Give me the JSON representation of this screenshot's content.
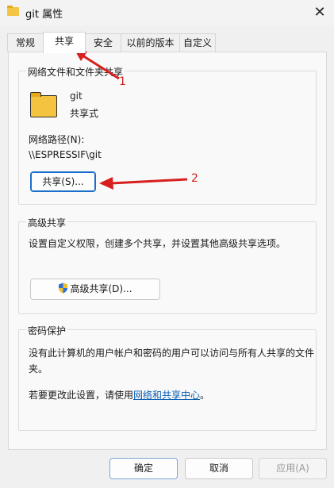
{
  "window": {
    "title": "git 属性",
    "close_glyph": "✕",
    "folder_icon": "folder-icon"
  },
  "tabs": [
    {
      "label": "常规"
    },
    {
      "label": "共享",
      "active": true
    },
    {
      "label": "安全"
    },
    {
      "label": "以前的版本"
    },
    {
      "label": "自定义"
    }
  ],
  "network_share": {
    "group_title": "网络文件和文件夹共享",
    "folder_name": "git",
    "share_status": "共享式",
    "path_label": "网络路径(N):",
    "path_value": "\\\\ESPRESSIF\\git",
    "share_button": "共享(S)..."
  },
  "advanced_share": {
    "group_title": "高级共享",
    "description": "设置自定义权限，创建多个共享，并设置其他高级共享选项。",
    "button": "高级共享(D)...",
    "button_icon": "uac-shield-icon"
  },
  "password_protection": {
    "group_title": "密码保护",
    "description_line1": "没有此计算机的用户帐户和密码的用户可以访问与所有人共享的文件",
    "description_line2": "夹。",
    "change_prefix": "若要更改此设置，请使用",
    "link_text": "网络和共享中心",
    "change_suffix": "。"
  },
  "footer": {
    "ok": "确定",
    "cancel": "取消",
    "apply": "应用(A)"
  },
  "annotations": {
    "label1": "1",
    "label2": "2",
    "color": "#d7201e"
  }
}
